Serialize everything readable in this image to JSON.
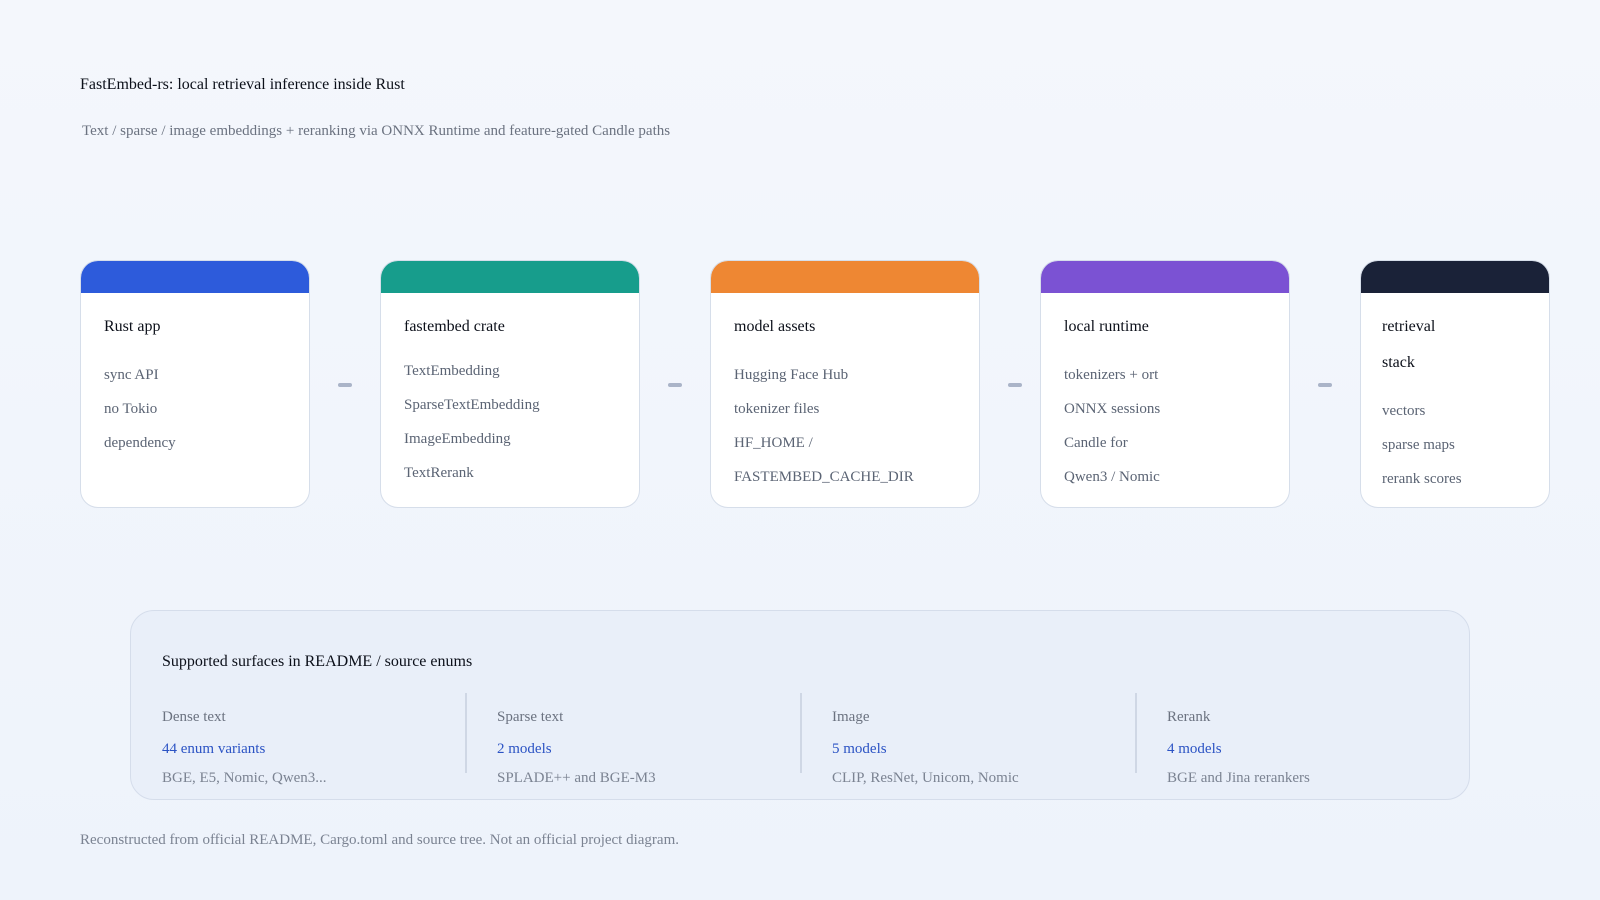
{
  "header": {
    "title": "FastEmbed-rs: local retrieval inference inside Rust",
    "subtitle": "Text / sparse / image embeddings + reranking via ONNX Runtime and feature-gated Candle paths"
  },
  "pipeline": [
    {
      "title": "Rust app",
      "color": "#2d5bdb",
      "items": [
        "sync API",
        "no Tokio",
        "dependency"
      ]
    },
    {
      "title": "fastembed crate",
      "color": "#179d8c",
      "items": [
        "TextEmbedding",
        "SparseTextEmbedding",
        "ImageEmbedding",
        "TextRerank"
      ]
    },
    {
      "title": "model assets",
      "color": "#ee8733",
      "items": [
        "Hugging Face Hub",
        "tokenizer files",
        "HF_HOME /",
        "FASTEMBED_CACHE_DIR"
      ]
    },
    {
      "title": "local runtime",
      "color": "#7b52d3",
      "items": [
        "tokenizers + ort",
        "ONNX sessions",
        "Candle for",
        "Qwen3 / Nomic"
      ]
    },
    {
      "title_lines": [
        "retrieval",
        "stack"
      ],
      "color": "#1a2238",
      "items": [
        "vectors",
        "sparse maps",
        "rerank scores"
      ]
    }
  ],
  "panel": {
    "title": "Supported surfaces in README / source enums",
    "columns": [
      {
        "label": "Dense text",
        "count": "44 enum variants",
        "detail": "BGE, E5, Nomic, Qwen3..."
      },
      {
        "label": "Sparse text",
        "count": "2 models",
        "detail": "SPLADE++ and BGE-M3"
      },
      {
        "label": "Image",
        "count": "5 models",
        "detail": "CLIP, ResNet, Unicom, Nomic"
      },
      {
        "label": "Rerank",
        "count": "4 models",
        "detail": "BGE and Jina rerankers"
      }
    ]
  },
  "footer": "Reconstructed from official README, Cargo.toml and source tree. Not an official project diagram."
}
